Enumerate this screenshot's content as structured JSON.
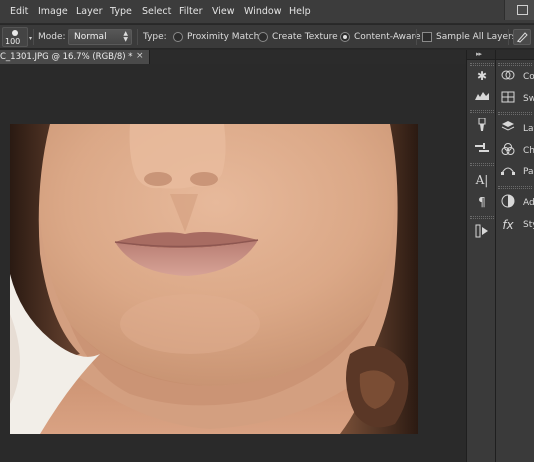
{
  "menubar": {
    "items": [
      {
        "label": "Edit"
      },
      {
        "label": "Image"
      },
      {
        "label": "Layer"
      },
      {
        "label": "Type"
      },
      {
        "label": "Select"
      },
      {
        "label": "Filter"
      },
      {
        "label": "View"
      },
      {
        "label": "Window"
      },
      {
        "label": "Help"
      }
    ]
  },
  "options_bar": {
    "brush_size": "100",
    "mode_label": "Mode:",
    "mode_value": "Normal",
    "type_label": "Type:",
    "type_options": [
      {
        "label": "Proximity Match",
        "selected": false
      },
      {
        "label": "Create Texture",
        "selected": false
      },
      {
        "label": "Content-Aware",
        "selected": true
      }
    ],
    "sample_all_layers_label": "Sample All Layers",
    "sample_all_layers_checked": false
  },
  "document": {
    "tab_title": "C_1301.JPG @ 16.7% (RGB/8) *",
    "close_glyph": "×"
  },
  "right_panels": {
    "collapse_glyph": "▸▸",
    "strip_a_icons": [
      "histogram-icon",
      "navigator-icon",
      "brush-panel-icon",
      "clone-source-icon",
      "character-icon",
      "paragraph-icon",
      "actions-icon"
    ],
    "strip_b_items": [
      {
        "label": "Co",
        "icon": "color-icon"
      },
      {
        "label": "Sw",
        "icon": "swatches-icon"
      },
      {
        "label": "Lay",
        "icon": "layers-icon"
      },
      {
        "label": "Ch",
        "icon": "channels-icon"
      },
      {
        "label": "Pa",
        "icon": "paths-icon"
      },
      {
        "label": "Ad",
        "icon": "adjustments-icon"
      },
      {
        "label": "Sty",
        "icon": "styles-icon"
      }
    ]
  },
  "colors": {
    "menubar_bg": "#3c3c3c",
    "options_bg": "#3a3a3a",
    "canvas_bg": "#2a2a2a",
    "panel_bg": "#3a3a3a"
  }
}
